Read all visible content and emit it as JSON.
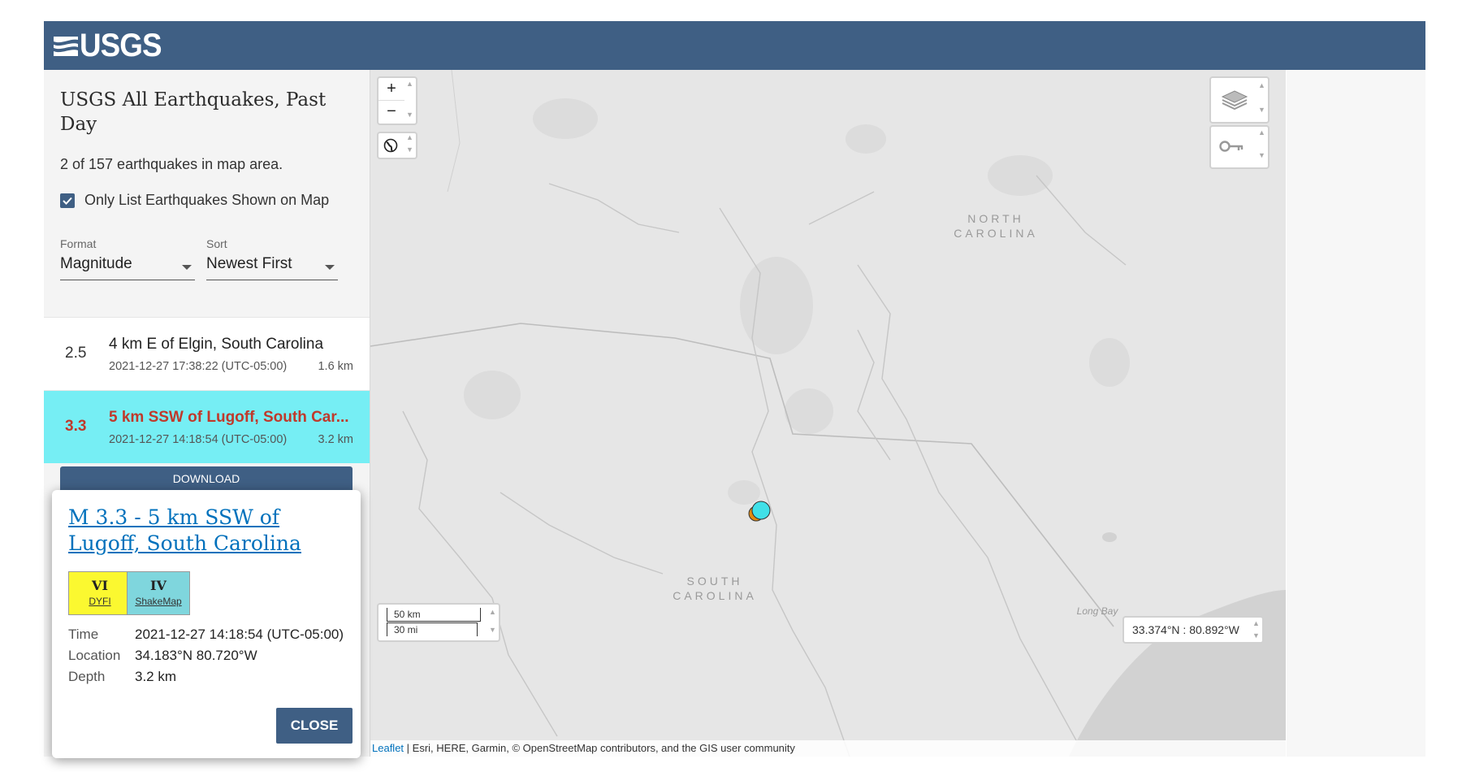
{
  "header": {
    "logo_text": "USGS"
  },
  "sidebar": {
    "title": "USGS All Earthquakes, Past Day",
    "count_text": "2 of 157 earthquakes in map area.",
    "only_list_label": "Only List Earthquakes Shown on Map",
    "only_list_checked": true,
    "format": {
      "label": "Format",
      "value": "Magnitude"
    },
    "sort": {
      "label": "Sort",
      "value": "Newest First"
    },
    "earthquakes": [
      {
        "mag": "2.5",
        "place": "4 km E of Elgin, South Carolina",
        "time": "2021-12-27 17:38:22 (UTC-05:00)",
        "depth": "1.6 km",
        "selected": false
      },
      {
        "mag": "3.3",
        "place": "5 km SSW of Lugoff, South Car...",
        "time": "2021-12-27 14:18:54 (UTC-05:00)",
        "depth": "3.2 km",
        "selected": true
      }
    ],
    "download_label": "DOWNLOAD"
  },
  "popup": {
    "title": "M 3.3 - 5 km SSW of Lugoff, South Carolina",
    "dyfi": {
      "roman": "VI",
      "label": "DYFI",
      "color": "#fbf830"
    },
    "shakemap": {
      "roman": "IV",
      "label": "ShakeMap",
      "color": "#7fd6dd"
    },
    "time_label": "Time",
    "time": "2021-12-27 14:18:54 (UTC-05:00)",
    "location_label": "Location",
    "location": "34.183°N 80.720°W",
    "depth_label": "Depth",
    "depth": "3.2 km",
    "close_label": "CLOSE"
  },
  "map": {
    "zoom_in": "+",
    "zoom_out": "−",
    "state_labels": [
      [
        "NORTH",
        "CAROLINA"
      ],
      [
        "SOUTH",
        "CAROLINA"
      ]
    ],
    "water_label": "Long Bay",
    "scale_km": "50 km",
    "scale_mi": "30 mi",
    "coordinates": "33.374°N : 80.892°W",
    "attribution_link": "Leaflet",
    "attribution_text": " | Esri, HERE, Garmin, © OpenStreetMap contributors, and the GIS user community",
    "marker_colors": {
      "selected": "#40e0e8",
      "other": "#e08a10"
    }
  }
}
